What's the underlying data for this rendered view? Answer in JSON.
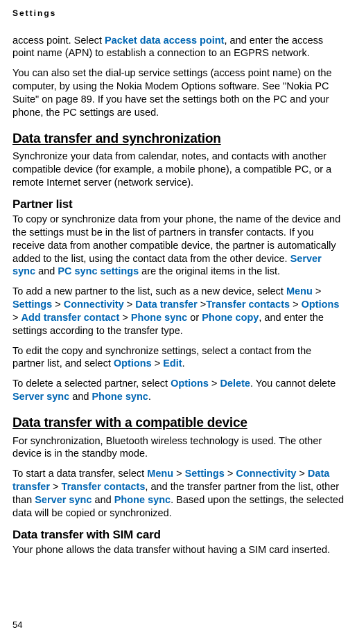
{
  "header": "Settings",
  "page_number": "54",
  "p1_a": "access point. Select ",
  "p1_link": "Packet data access point",
  "p1_b": ", and enter the access point name (APN) to establish a connection to an EGPRS network.",
  "p2": "You can also set the dial-up service settings (access point name) on the computer, by using the Nokia Modem Options software. See \"Nokia PC Suite\" on page 89. If you have set the settings both on the PC and your phone, the PC settings are used.",
  "h_data_transfer": "Data transfer and synchronization",
  "p3": "Synchronize your data from calendar, notes, and contacts with another compatible device (for example, a mobile phone), a compatible PC, or a remote Internet server (network service).",
  "h_partner": "Partner list",
  "p4_a": "To copy or synchronize data from your phone, the name of the device and the settings must be in the list of partners in transfer contacts. If you receive data from another compatible device, the partner is automatically added to the list, using the contact data from the other device. ",
  "p4_link1": "Server sync",
  "p4_b": " and ",
  "p4_link2": "PC sync settings",
  "p4_c": " are the original items in the list.",
  "p5_a": "To add a new partner to the list, such as a new device, select ",
  "p5_menu": "Menu",
  "p5_sep": " > ",
  "p5_settings": "Settings",
  "p5_connectivity": "Connectivity",
  "p5_data_transfer": "Data transfer",
  "p5_sep2": " >",
  "p5_transfer_contacts": "Transfer contacts",
  "p5_options": "Options",
  "p5_add": "Add transfer contact",
  "p5_phone_sync": "Phone sync",
  "p5_or": " or ",
  "p5_phone_copy": "Phone copy",
  "p5_b": ", and enter the settings according to the transfer type.",
  "p6_a": "To edit the copy and synchronize settings, select a contact from the partner list, and select ",
  "p6_options": "Options",
  "p6_edit": "Edit",
  "p6_b": ".",
  "p7_a": "To delete a selected partner, select ",
  "p7_options": "Options",
  "p7_delete": "Delete",
  "p7_b": ". You cannot delete ",
  "p7_server": "Server sync",
  "p7_c": " and ",
  "p7_phone": "Phone sync",
  "p7_d": ".",
  "h_compat": "Data transfer with a compatible device",
  "p8": "For synchronization, Bluetooth wireless technology is used. The other device is in the standby mode.",
  "p9_a": "To start a data transfer, select ",
  "p9_menu": "Menu",
  "p9_settings": "Settings",
  "p9_connectivity": "Connectivity",
  "p9_data_transfer": "Data transfer",
  "p9_transfer_contacts": "Transfer contacts",
  "p9_b": ", and the transfer partner from the list, other than ",
  "p9_server": "Server sync",
  "p9_c": " and ",
  "p9_phone": "Phone sync",
  "p9_d": ". Based upon the settings, the selected data will be copied or synchronized.",
  "h_sim": "Data transfer with SIM card",
  "p10": "Your phone allows the data transfer without having a SIM card inserted."
}
